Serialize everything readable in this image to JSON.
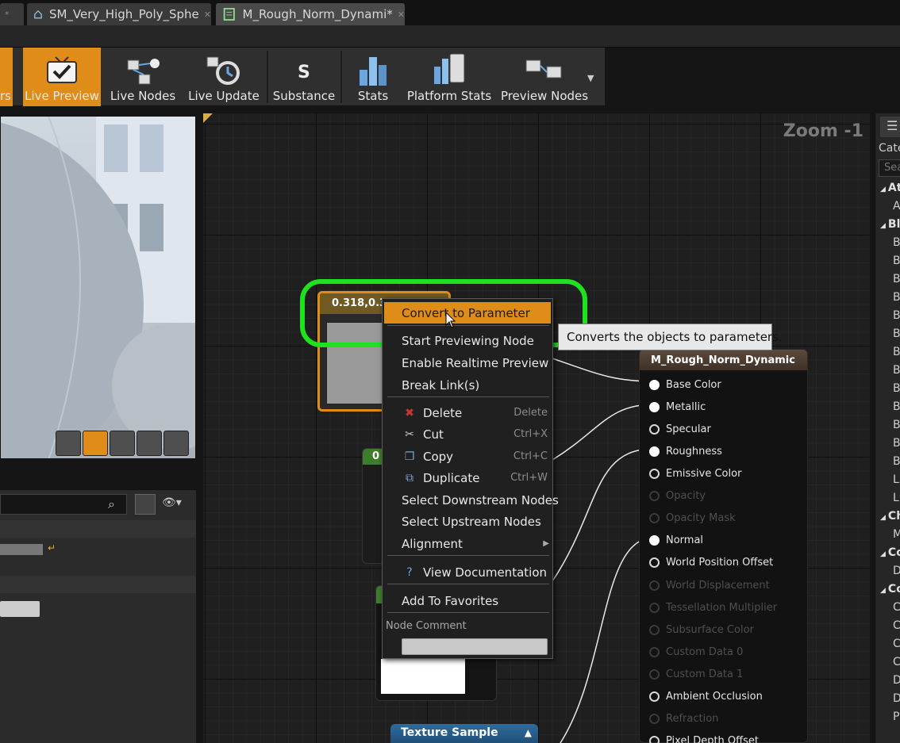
{
  "tabs": [
    {
      "label": "*",
      "icon": "close-icon"
    },
    {
      "label": "SM_Very_High_Poly_Sphe",
      "icon": "static-mesh-icon"
    },
    {
      "label": "M_Rough_Norm_Dynami*",
      "icon": "material-icon"
    }
  ],
  "toolbar": {
    "partial_label": "rs",
    "buttons": [
      {
        "label": "Live Preview",
        "active": true
      },
      {
        "label": "Live Nodes"
      },
      {
        "label": "Live Update"
      },
      {
        "label": "Substance"
      },
      {
        "label": "Stats"
      },
      {
        "label": "Platform Stats"
      },
      {
        "label": "Preview Nodes"
      }
    ]
  },
  "graph": {
    "zoom": "Zoom -1",
    "constant_node": {
      "title": "0.318,0.31"
    },
    "node2": {
      "title": "0"
    },
    "texture_node": {
      "title": "Texture Sample",
      "collapse": "▲"
    },
    "material_node": {
      "title": "M_Rough_Norm_Dynamic",
      "pins": [
        {
          "label": "Base Color",
          "state": "connected"
        },
        {
          "label": "Metallic",
          "state": "connected"
        },
        {
          "label": "Specular",
          "state": "open"
        },
        {
          "label": "Roughness",
          "state": "connected"
        },
        {
          "label": "Emissive Color",
          "state": "open"
        },
        {
          "label": "Opacity",
          "state": "disabled"
        },
        {
          "label": "Opacity Mask",
          "state": "disabled"
        },
        {
          "label": "Normal",
          "state": "connected"
        },
        {
          "label": "World Position Offset",
          "state": "open"
        },
        {
          "label": "World Displacement",
          "state": "disabled"
        },
        {
          "label": "Tessellation Multiplier",
          "state": "disabled"
        },
        {
          "label": "Subsurface Color",
          "state": "disabled"
        },
        {
          "label": "Custom Data 0",
          "state": "disabled"
        },
        {
          "label": "Custom Data 1",
          "state": "disabled"
        },
        {
          "label": "Ambient Occlusion",
          "state": "open"
        },
        {
          "label": "Refraction",
          "state": "disabled"
        },
        {
          "label": "Pixel Depth Offset",
          "state": "open"
        }
      ]
    }
  },
  "context_menu": {
    "items": [
      {
        "label": "Convert to Parameter",
        "highlighted": true
      },
      {
        "label": "Start Previewing Node"
      },
      {
        "label": "Enable Realtime Preview"
      },
      {
        "label": "Break Link(s)"
      },
      {
        "label": "Delete",
        "shortcut": "Delete",
        "icon": "delete-icon"
      },
      {
        "label": "Cut",
        "shortcut": "Ctrl+X",
        "icon": "cut-icon"
      },
      {
        "label": "Copy",
        "shortcut": "Ctrl+C",
        "icon": "copy-icon"
      },
      {
        "label": "Duplicate",
        "shortcut": "Ctrl+W",
        "icon": "duplicate-icon"
      },
      {
        "label": "Select Downstream Nodes"
      },
      {
        "label": "Select Upstream Nodes"
      },
      {
        "label": "Alignment",
        "submenu": true
      },
      {
        "label": "View Documentation",
        "icon": "help-icon"
      },
      {
        "label": "Add To Favorites"
      }
    ],
    "node_comment_label": "Node Comment",
    "node_comment_value": ""
  },
  "tooltip": "Converts the objects to parameters.",
  "right_panel": {
    "header": "Cate",
    "search_placeholder": "Sea",
    "rows": [
      {
        "text": "At",
        "bold": true
      },
      {
        "text": "A"
      },
      {
        "text": "Bl",
        "bold": true
      },
      {
        "text": "B"
      },
      {
        "text": "B"
      },
      {
        "text": "B"
      },
      {
        "text": "B"
      },
      {
        "text": "B"
      },
      {
        "text": "B"
      },
      {
        "text": "B"
      },
      {
        "text": "B"
      },
      {
        "text": "B"
      },
      {
        "text": "B"
      },
      {
        "text": "B"
      },
      {
        "text": "B"
      },
      {
        "text": "B"
      },
      {
        "text": "L"
      },
      {
        "text": "L"
      },
      {
        "text": "Ch",
        "bold": true
      },
      {
        "text": "M"
      },
      {
        "text": "Co",
        "bold": true
      },
      {
        "text": "D"
      },
      {
        "text": "Co",
        "bold": true
      },
      {
        "text": "C"
      },
      {
        "text": "C"
      },
      {
        "text": "C"
      },
      {
        "text": "C"
      },
      {
        "text": "D"
      },
      {
        "text": "D"
      },
      {
        "text": "P"
      }
    ]
  },
  "colors": {
    "accent": "#e08c18",
    "highlight_ring": "#1fe21f"
  }
}
